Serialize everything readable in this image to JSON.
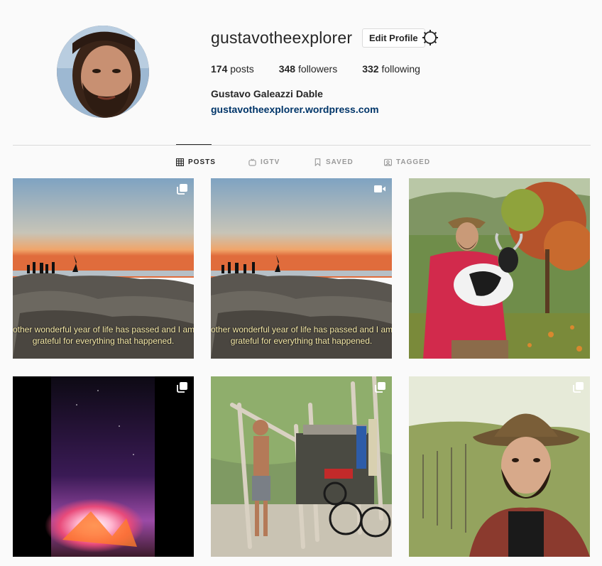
{
  "profile": {
    "username": "gustavotheexplorer",
    "edit_label": "Edit Profile",
    "full_name": "Gustavo Galeazzi Dable",
    "website": "gustavotheexplorer.wordpress.com",
    "stats": [
      {
        "count": "174",
        "label": "posts"
      },
      {
        "count": "348",
        "label": "followers"
      },
      {
        "count": "332",
        "label": "following"
      }
    ]
  },
  "tabs": [
    {
      "label": "POSTS",
      "icon": "grid-icon",
      "active": true
    },
    {
      "label": "IGTV",
      "icon": "igtv-icon",
      "active": false
    },
    {
      "label": "SAVED",
      "icon": "bookmark-icon",
      "active": false
    },
    {
      "label": "TAGGED",
      "icon": "tagged-icon",
      "active": false
    }
  ],
  "posts": [
    {
      "scene": "sunset-rocks",
      "badge": "carousel-icon",
      "caption_line1": "other wonderful year of life has passed and I am",
      "caption_line2": "grateful for  everything that happened."
    },
    {
      "scene": "sunset-rocks",
      "badge": "video-icon",
      "caption_line1": "other wonderful year of life has passed and I am",
      "caption_line2": "grateful for  everything that happened."
    },
    {
      "scene": "man-with-goat",
      "badge": ""
    },
    {
      "scene": "campfire-night",
      "badge": "carousel-icon"
    },
    {
      "scene": "driftwood-hut",
      "badge": "carousel-icon"
    },
    {
      "scene": "man-in-hat",
      "badge": "carousel-icon"
    }
  ],
  "colors": {
    "text": "#262626",
    "secondary": "#999999",
    "link": "#003569",
    "border": "#dbdbdb",
    "background": "#fafafa"
  }
}
